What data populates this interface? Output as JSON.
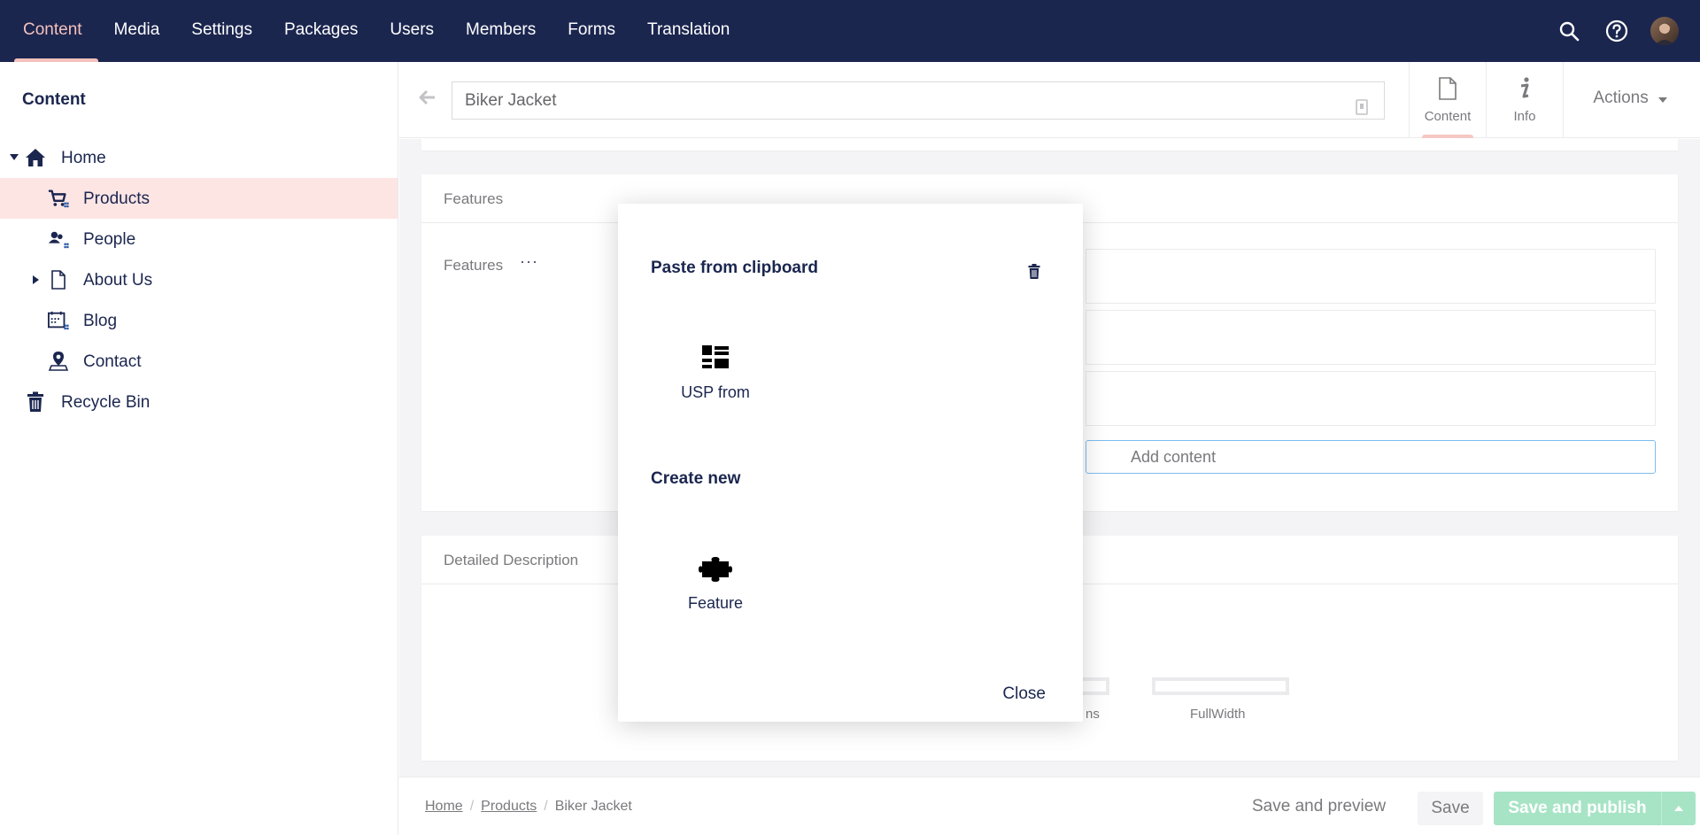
{
  "topnav": {
    "items": [
      {
        "label": "Content",
        "active": true
      },
      {
        "label": "Media"
      },
      {
        "label": "Settings"
      },
      {
        "label": "Packages"
      },
      {
        "label": "Users"
      },
      {
        "label": "Members"
      },
      {
        "label": "Forms"
      },
      {
        "label": "Translation"
      }
    ],
    "tools": [
      "search-icon",
      "help-icon",
      "avatar"
    ]
  },
  "sidebar": {
    "title": "Content",
    "items": [
      {
        "label": "Home",
        "icon": "home-icon",
        "expanded": true
      },
      {
        "label": "Products",
        "icon": "shopping-cart-icon",
        "active": true
      },
      {
        "label": "People",
        "icon": "people-icon"
      },
      {
        "label": "About Us",
        "icon": "document-icon",
        "collapsed": true
      },
      {
        "label": "Blog",
        "icon": "calendar-icon"
      },
      {
        "label": "Contact",
        "icon": "map-pin-icon"
      },
      {
        "label": "Recycle Bin",
        "icon": "trash-icon"
      }
    ]
  },
  "editor": {
    "name": "Biker Jacket",
    "tabs": [
      {
        "label": "Content",
        "icon": "document-icon",
        "active": true
      },
      {
        "label": "Info",
        "icon": "info-icon"
      }
    ],
    "actions_label": "Actions"
  },
  "panels": {
    "features": {
      "title": "Features",
      "property_label": "Features",
      "add_content": "Add content"
    },
    "detailed": {
      "title": "Detailed Description",
      "layout_partial_text": "ns",
      "layout_fullwidth": "FullWidth"
    }
  },
  "footer": {
    "breadcrumb": [
      "Home",
      "Products",
      "Biker Jacket"
    ],
    "save_preview": "Save and preview",
    "save": "Save",
    "save_publish": "Save and publish"
  },
  "dialog": {
    "paste_title": "Paste from clipboard",
    "paste_item": {
      "label": "USP from",
      "icon": "list-grid-icon"
    },
    "create_title": "Create new",
    "create_item": {
      "label": "Feature",
      "icon": "puzzle-icon"
    },
    "close_label": "Close"
  },
  "colors": {
    "nav_bg": "#1b264f",
    "nav_active": "#f5c1bc",
    "sidebar_active_bg": "#fde5e4",
    "publish_btn": "#9be1bf",
    "add_content_border": "#6ab4f0"
  }
}
